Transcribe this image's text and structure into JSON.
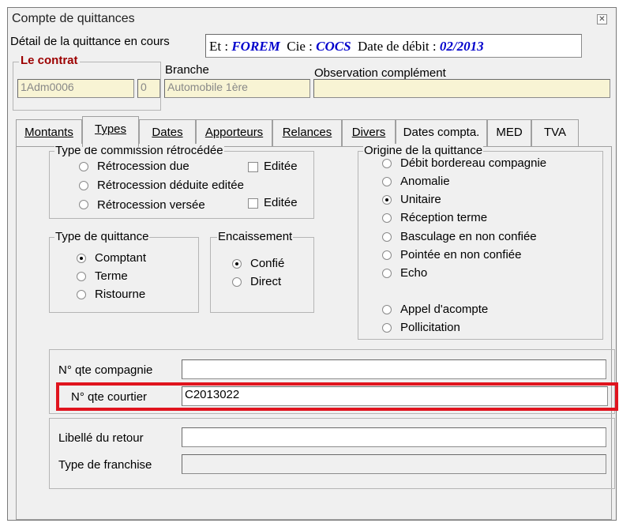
{
  "window": {
    "title": "Compte de quittances",
    "close_icon": "close-icon"
  },
  "detail": {
    "label": "Détail de la quittance en cours",
    "et_label": "Et :",
    "et_value": "FOREM",
    "cie_label": "Cie :",
    "cie_value": "COCS",
    "date_label": "Date de débit :",
    "date_value": "02/2013"
  },
  "contract": {
    "label": "Le contrat",
    "code": "1Adm0006",
    "num": "0",
    "branche_label": "Branche",
    "branche_value": "Automobile 1ère",
    "obs_label": "Observation complément",
    "obs_value": ""
  },
  "tabs": [
    "Montants",
    "Types",
    "Dates",
    "Apporteurs",
    "Relances",
    "Divers",
    "Dates compta.",
    "MED",
    "TVA"
  ],
  "active_tab": "Types",
  "commission": {
    "title": "Type de commission rétrocédée",
    "options": [
      "Rétrocession due",
      "Rétrocession déduite editée",
      "Rétrocession versée"
    ],
    "editee1": "Editée",
    "editee2": "Editée"
  },
  "origine": {
    "title": "Origine de la quittance",
    "options": [
      "Débit bordereau compagnie",
      "Anomalie",
      "Unitaire",
      "Réception terme",
      "Basculage en non confiée",
      "Pointée en non confiée",
      "Echo",
      "Appel d'acompte",
      "Pollicitation"
    ],
    "selected": "Unitaire"
  },
  "type_quittance": {
    "title": "Type de quittance",
    "options": [
      "Comptant",
      "Terme",
      "Ristourne"
    ],
    "selected": "Comptant"
  },
  "encaissement": {
    "title": "Encaissement",
    "options": [
      "Confié",
      "Direct"
    ],
    "selected": "Confié"
  },
  "numeros": {
    "compagnie_label": "N° qte compagnie",
    "compagnie_value": "",
    "courtier_label": "N° qte courtier",
    "courtier_value": "C2013022"
  },
  "retour": {
    "libelle_label": "Libellé du retour",
    "libelle_value": "",
    "franchise_label": "Type de franchise",
    "franchise_value": ""
  },
  "colors": {
    "highlight": "#e0141e",
    "contract_label": "#9c0000",
    "detail_value": "#0000cc",
    "readonly_bg": "#f8f4d4"
  }
}
